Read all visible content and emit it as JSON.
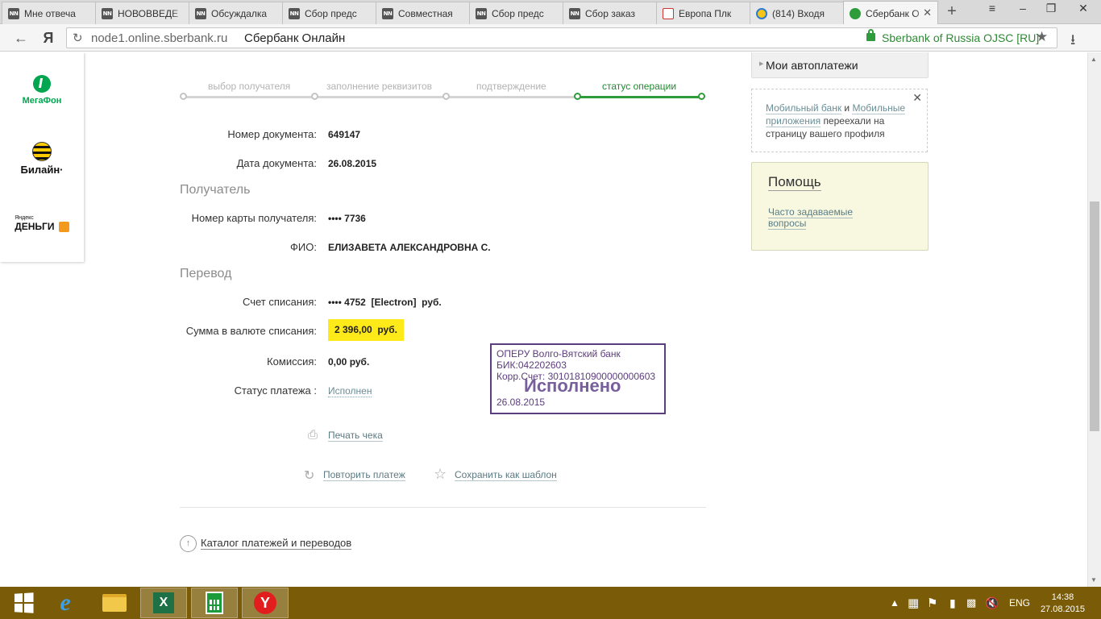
{
  "browser": {
    "tabs": [
      {
        "title": "Мне отвеча",
        "favicon": "NN"
      },
      {
        "title": "НОВОВВЕДЕ",
        "favicon": "NN"
      },
      {
        "title": "Обсуждалка",
        "favicon": "NN"
      },
      {
        "title": "Сбор предс",
        "favicon": "NN"
      },
      {
        "title": "Совместная",
        "favicon": "NN"
      },
      {
        "title": "Сбор предс",
        "favicon": "NN"
      },
      {
        "title": "Сбор заказ",
        "favicon": "NN"
      },
      {
        "title": "Европа Плк",
        "favicon": "europa"
      },
      {
        "title": "(814) Входя",
        "favicon": "mail"
      },
      {
        "title": "Сбербанк О",
        "favicon": "sberbank",
        "active": true
      }
    ],
    "new_tab": "+",
    "window_buttons": {
      "menu": "≡",
      "minimize": "–",
      "restore": "❐",
      "close": "✕"
    },
    "back": "←",
    "ya": "Я",
    "reload": "↻",
    "url": "node1.online.sberbank.ru",
    "page_title": "Сбербанк Онлайн",
    "certificate": "Sberbank of Russia OJSC [RU]",
    "bookmark": "★",
    "download": "⭳"
  },
  "left_logos": {
    "megafon": "МегаФон",
    "beeline": "Билайн·",
    "yandex_small": "Яндекс",
    "yandex_big": "ДЕНЬГИ"
  },
  "steps": [
    {
      "label": "выбор получателя",
      "state": "done"
    },
    {
      "label": "заполнение реквизитов",
      "state": "done"
    },
    {
      "label": "подтверждение",
      "state": "done"
    },
    {
      "label": "статус операции",
      "state": "active"
    }
  ],
  "document": {
    "number_label": "Номер документа:",
    "number": "649147",
    "date_label": "Дата документа:",
    "date": "26.08.2015"
  },
  "recipient": {
    "section": "Получатель",
    "card_label": "Номер карты получателя:",
    "card": "•••• 7736",
    "name_label": "ФИО:",
    "name": "ЕЛИЗАВЕТА АЛЕКСАНДРОВНА С."
  },
  "transfer": {
    "section": "Перевод",
    "account_label": "Счет списания:",
    "account": "•••• 4752  [Electron]  руб.",
    "amount_label": "Сумма в валюте списания:",
    "amount": "2 396,00  руб.",
    "fee_label": "Комиссия:",
    "fee": "0,00 руб.",
    "status_label": "Статус платежа :",
    "status": "Исполнен"
  },
  "stamp": {
    "bank": "ОПЕРУ Волго-Вятский банк",
    "bik": "БИК:042202603",
    "corr": "Корр.Счет: 30101810900000000603",
    "status": "Исполнено",
    "date": "26.08.2015"
  },
  "actions": {
    "print": "Печать чека",
    "repeat": "Повторить платеж",
    "save_template": "Сохранить как шаблон",
    "catalog": "Каталог платежей и переводов"
  },
  "sidebar": {
    "autopay": "Мои автоплатежи",
    "notice_link1": "Мобильный банк",
    "notice_and": "и",
    "notice_link2": "Мобильные приложения",
    "notice_rest": "переехали на страницу вашего профиля",
    "help_title": "Помощь",
    "help_faq": "Часто задаваемые вопросы"
  },
  "taskbar": {
    "language": "ENG",
    "time": "14:38",
    "date": "27.08.2015",
    "apps": [
      "start-icon",
      "ie-icon",
      "explorer-icon",
      "excel-icon",
      "calculator-icon",
      "yandex-browser-icon"
    ]
  },
  "colors": {
    "accent_green": "#2e9c3a",
    "amount_highlight": "#ffea19",
    "stamp_purple": "#5c3d7d",
    "taskbar": "#7a5c08"
  }
}
